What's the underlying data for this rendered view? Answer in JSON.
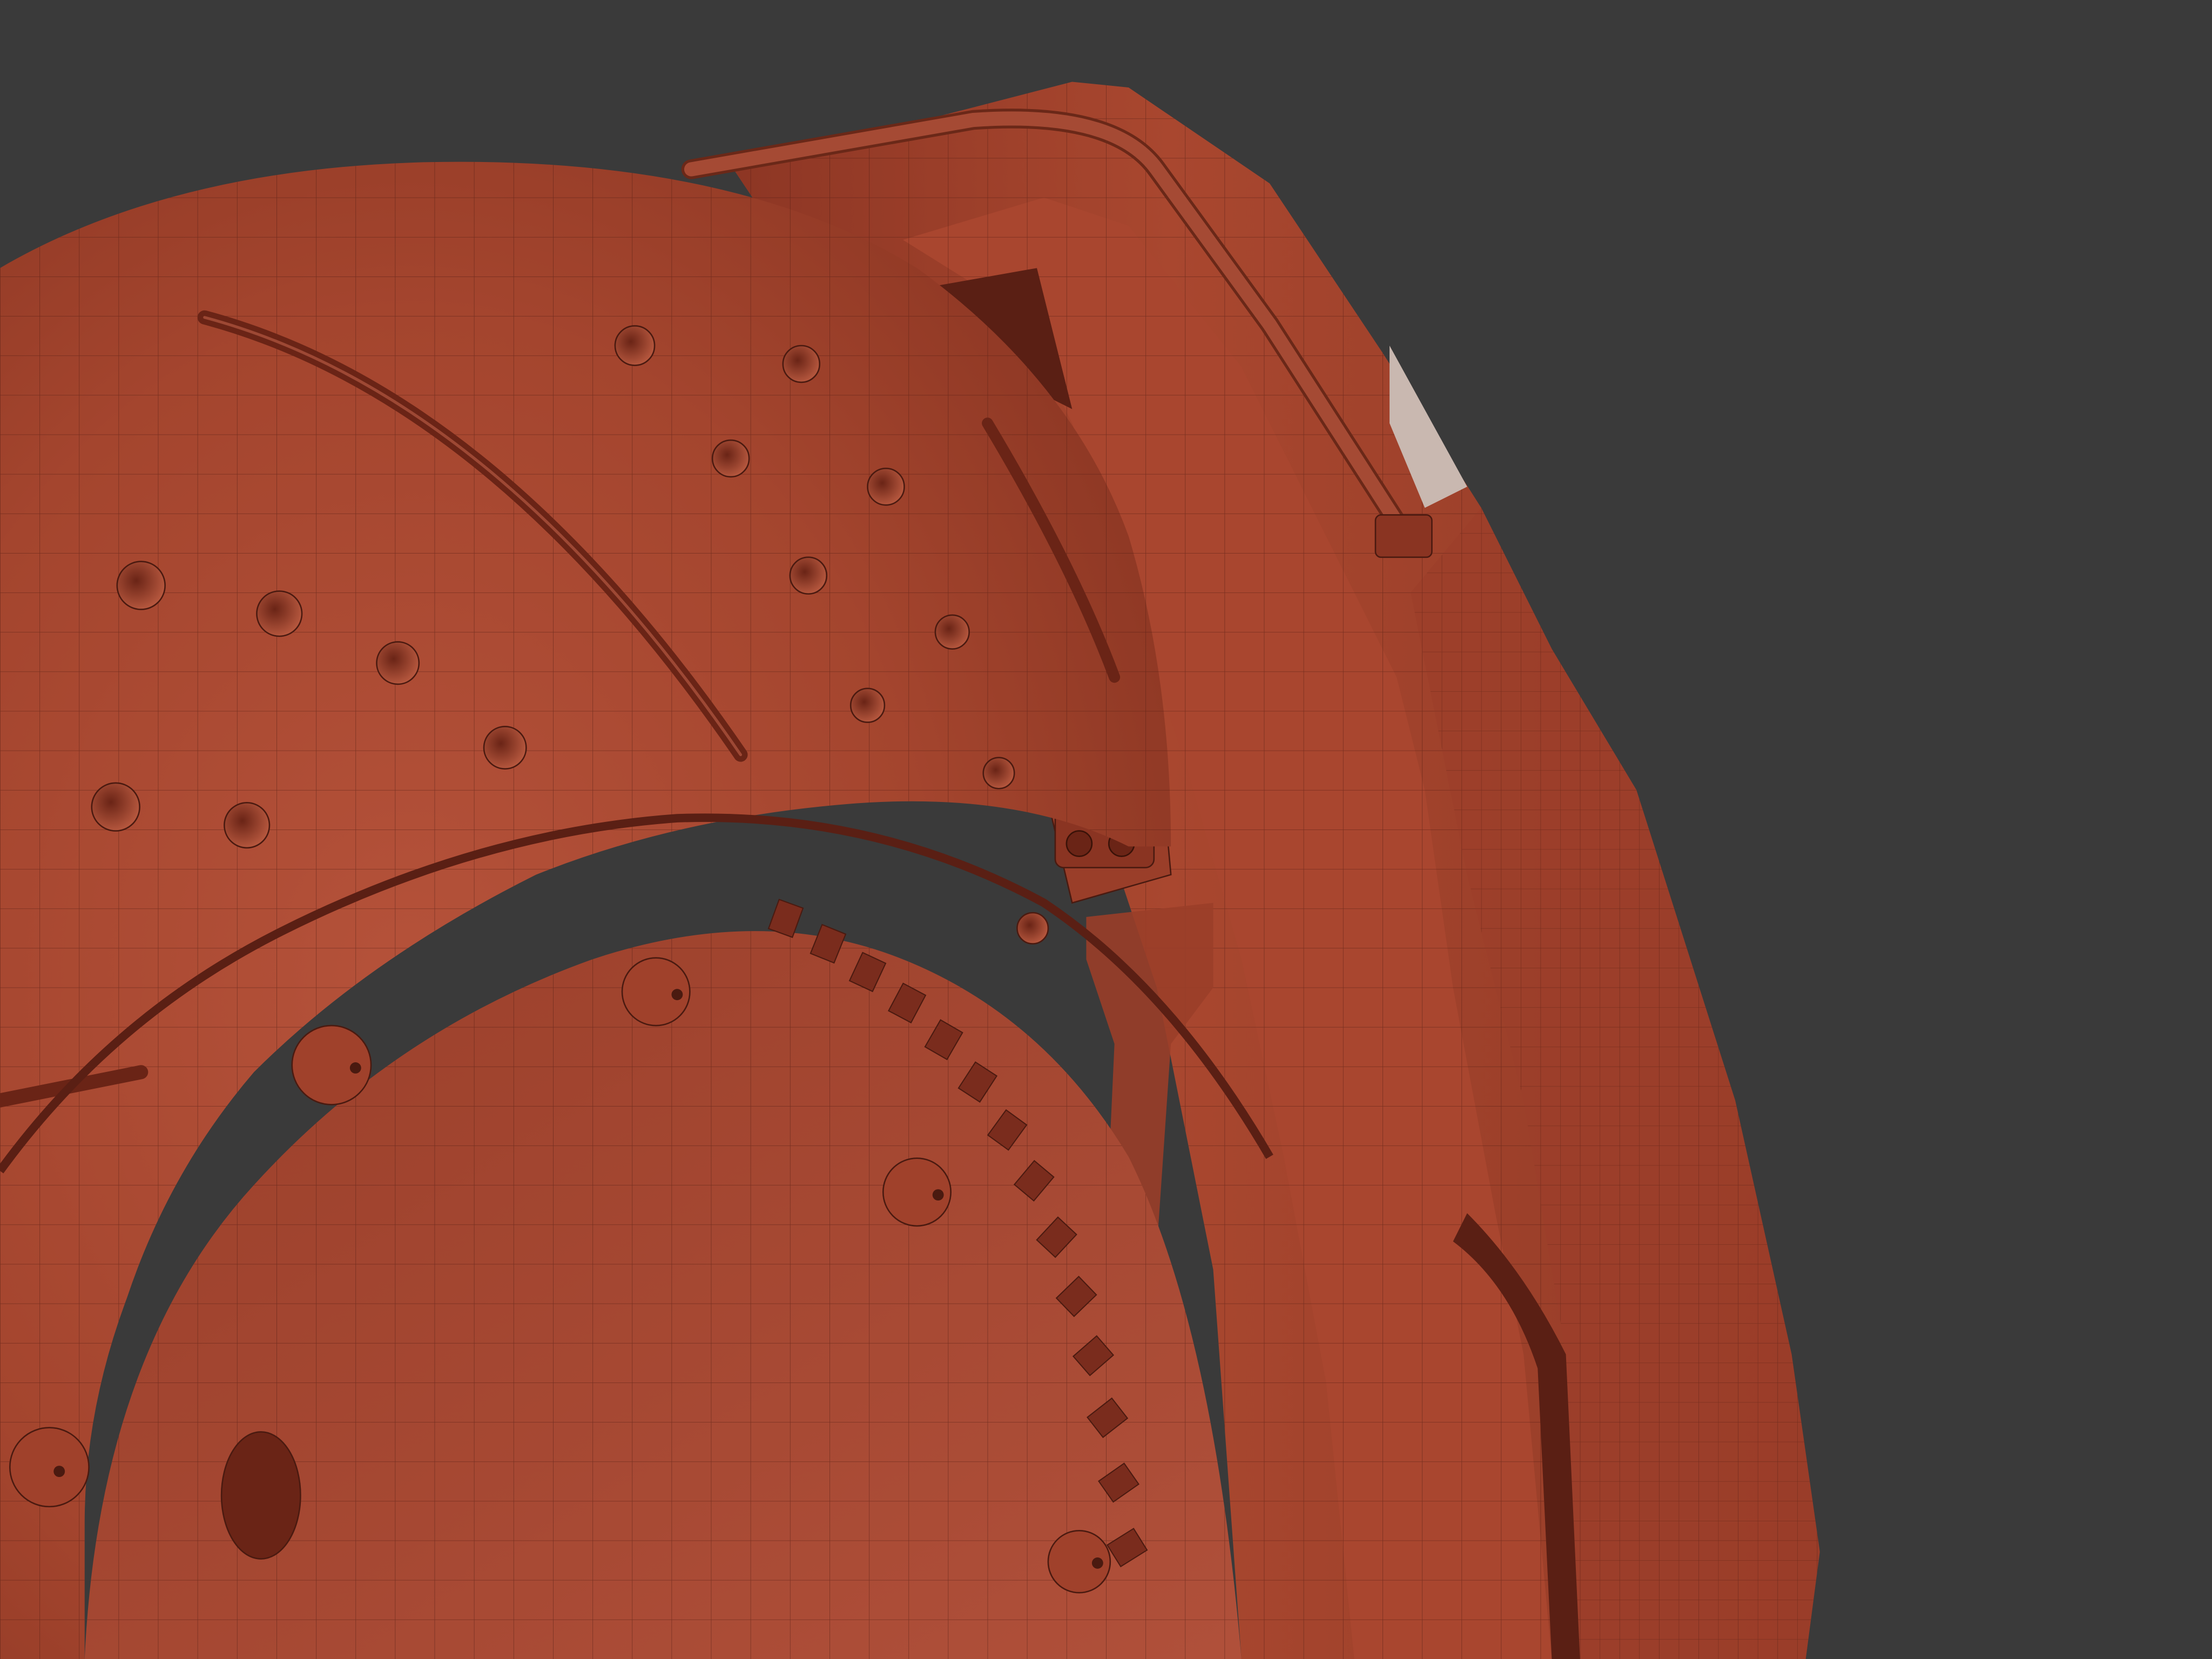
{
  "scene": {
    "subject": "brake-disc-and-caliper-wireframe-render",
    "colors": {
      "background": "#3a3a3a",
      "surface": "#a8462f",
      "surface_light": "#b9553a",
      "surface_dark": "#7a2c1d",
      "shadow": "#5a1f14",
      "wire": "#4a1a10"
    }
  }
}
